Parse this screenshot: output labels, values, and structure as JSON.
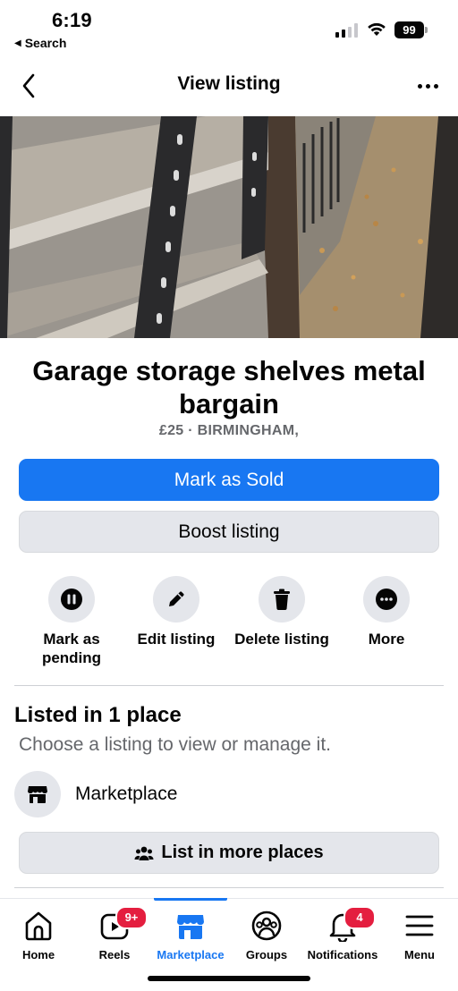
{
  "status_bar": {
    "time": "6:19",
    "back_label": "Search",
    "battery": "99"
  },
  "header": {
    "title": "View listing",
    "back_icon": "chevron-left-icon",
    "more_icon": "more-horizontal-icon"
  },
  "carousel": {
    "count": 3,
    "active_index": 0
  },
  "listing": {
    "title": "Garage storage shelves metal bargain",
    "meta": "£25 · BIRMINGHAM,"
  },
  "buttons": {
    "mark_sold": "Mark as Sold",
    "boost": "Boost listing",
    "list_more_places": "List in more places"
  },
  "actions": [
    {
      "label": "Mark as pending",
      "icon": "pause-icon"
    },
    {
      "label": "Edit listing",
      "icon": "pencil-icon"
    },
    {
      "label": "Delete listing",
      "icon": "trash-icon"
    },
    {
      "label": "More",
      "icon": "more-horizontal-icon"
    }
  ],
  "listed": {
    "title": "Listed in 1 place",
    "subtitle": "Choose a listing to view or manage it.",
    "place": "Marketplace"
  },
  "tabs": [
    {
      "label": "Home",
      "icon": "home-icon",
      "badge": ""
    },
    {
      "label": "Reels",
      "icon": "reels-icon",
      "badge": "9+"
    },
    {
      "label": "Marketplace",
      "icon": "marketplace-icon",
      "badge": "",
      "active": true
    },
    {
      "label": "Groups",
      "icon": "groups-icon",
      "badge": ""
    },
    {
      "label": "Notifications",
      "icon": "bell-icon",
      "badge": "4"
    },
    {
      "label": "Menu",
      "icon": "menu-icon",
      "badge": ""
    }
  ],
  "colors": {
    "accent": "#1877f2",
    "badge": "#e41e3f",
    "secondary_bg": "#e4e6eb",
    "muted_text": "#65676b"
  }
}
